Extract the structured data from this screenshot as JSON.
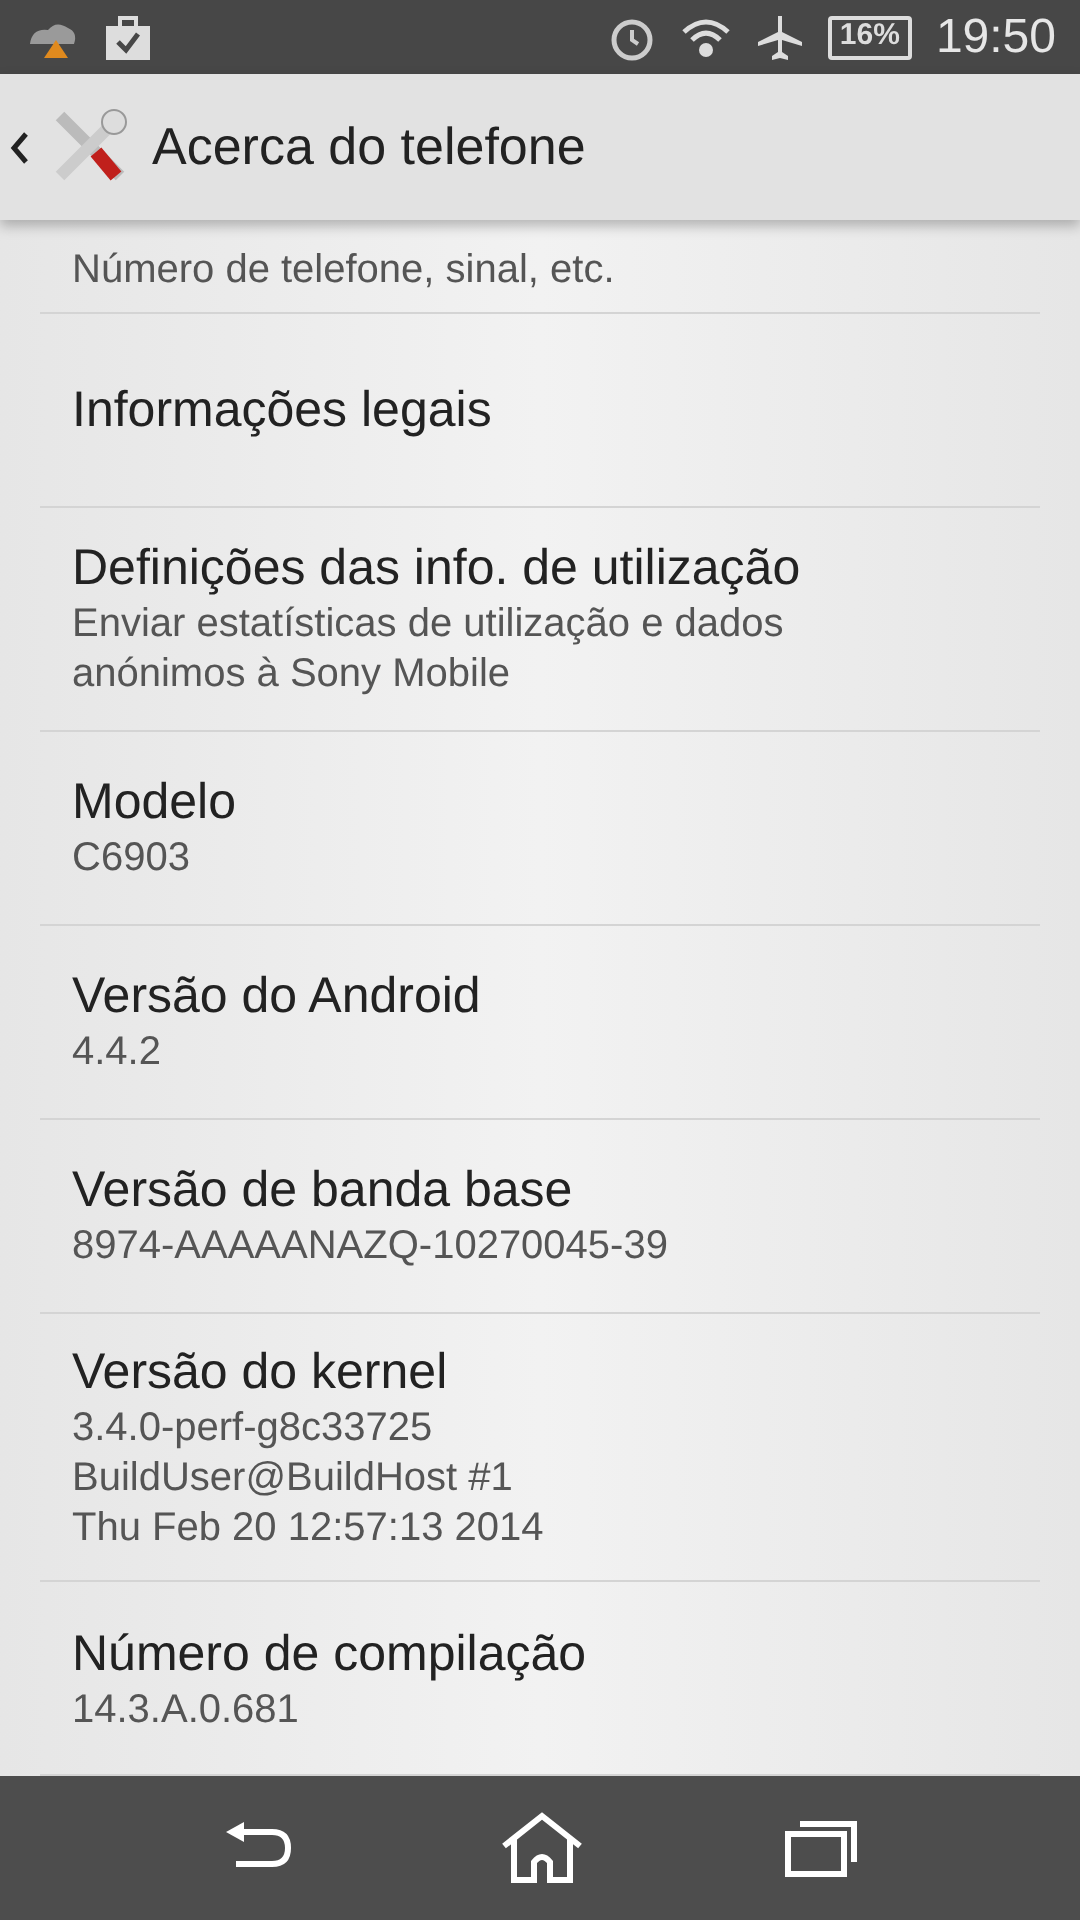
{
  "status_bar": {
    "battery": "16%",
    "time": "19:50"
  },
  "action_bar": {
    "title": "Acerca do telefone"
  },
  "items": [
    {
      "subtitle_lines": [
        "Número de telefone, sinal, etc."
      ]
    },
    {
      "title": "Informações legais"
    },
    {
      "title": "Definições das info. de utilização",
      "subtitle_lines": [
        "Enviar estatísticas de utilização e dados",
        "anónimos à Sony Mobile"
      ]
    },
    {
      "title": "Modelo",
      "subtitle_lines": [
        "C6903"
      ]
    },
    {
      "title": "Versão do Android",
      "subtitle_lines": [
        "4.4.2"
      ]
    },
    {
      "title": "Versão de banda base",
      "subtitle_lines": [
        "8974-AAAAANAZQ-10270045-39"
      ]
    },
    {
      "title": "Versão do kernel",
      "subtitle_lines": [
        "3.4.0-perf-g8c33725",
        "BuildUser@BuildHost #1",
        "Thu Feb 20 12:57:13 2014"
      ]
    },
    {
      "title": "Número de compilação",
      "subtitle_lines": [
        "14.3.A.0.681"
      ]
    }
  ]
}
